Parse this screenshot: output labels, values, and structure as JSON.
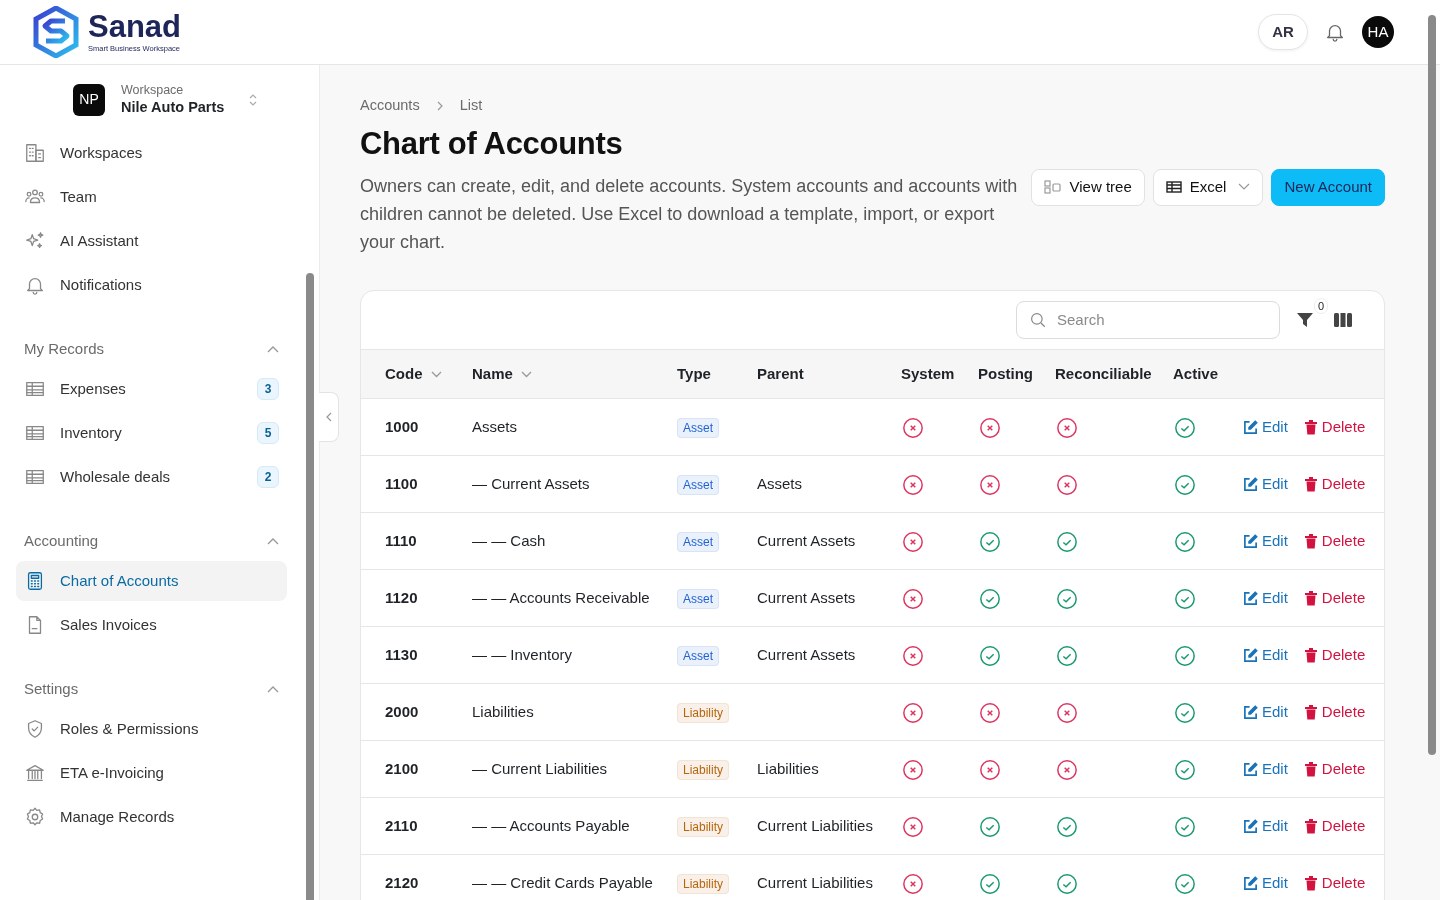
{
  "brand": {
    "name": "Sanad",
    "tagline": "Smart Business Workspace"
  },
  "header": {
    "language": "AR",
    "avatar": "HA"
  },
  "workspace": {
    "label": "Workspace",
    "name": "Nile Auto Parts",
    "initials": "NP"
  },
  "sidebar": {
    "items": [
      {
        "label": "Workspaces",
        "selected": false
      },
      {
        "label": "Team",
        "selected": false
      },
      {
        "label": "AI Assistant",
        "selected": false
      },
      {
        "label": "Notifications",
        "selected": false
      }
    ],
    "sections": [
      {
        "title": "My Records",
        "expanded": true,
        "items": [
          {
            "label": "Expenses",
            "badge": "3",
            "selected": false
          },
          {
            "label": "Inventory",
            "badge": "5",
            "selected": false
          },
          {
            "label": "Wholesale deals",
            "badge": "2",
            "selected": false
          }
        ]
      },
      {
        "title": "Accounting",
        "expanded": true,
        "items": [
          {
            "label": "Chart of Accounts",
            "selected": true
          },
          {
            "label": "Sales Invoices",
            "selected": false
          }
        ]
      },
      {
        "title": "Settings",
        "expanded": true,
        "items": [
          {
            "label": "Roles & Permissions",
            "selected": false
          },
          {
            "label": "ETA e-Invoicing",
            "selected": false
          },
          {
            "label": "Manage Records",
            "selected": false
          }
        ]
      }
    ]
  },
  "breadcrumbs": [
    "Accounts",
    "List"
  ],
  "title": "Chart of Accounts",
  "description": "Owners can create, edit, and delete accounts. System accounts and accounts with children cannot be deleted. Use Excel to download a template, import, or export your chart.",
  "actions": [
    {
      "label": "View tree",
      "kind": "tree"
    },
    {
      "label": "Excel",
      "kind": "dropdown"
    },
    {
      "label": "New Account",
      "kind": "primary"
    }
  ],
  "table": {
    "search": {
      "placeholder": "Search"
    },
    "filter_count": "0",
    "columns": [
      {
        "label": "Code",
        "sortable": true
      },
      {
        "label": "Name",
        "sortable": true
      },
      {
        "label": "Type",
        "sortable": false
      },
      {
        "label": "Parent",
        "sortable": false
      },
      {
        "label": "System",
        "sortable": false
      },
      {
        "label": "Posting",
        "sortable": false
      },
      {
        "label": "Reconciliable",
        "sortable": false
      },
      {
        "label": "Active",
        "sortable": false
      }
    ],
    "rows": [
      {
        "code": "1000",
        "name": "Assets",
        "type": {
          "label": "Asset",
          "color": "#1f63d6"
        },
        "parent": "",
        "system": false,
        "posting": false,
        "reconcilable": false,
        "active": true,
        "edit": "Edit",
        "delete": "Delete"
      },
      {
        "code": "1100",
        "name": "— Current Assets",
        "type": {
          "label": "Asset",
          "color": "#1f63d6"
        },
        "parent": "Assets",
        "system": false,
        "posting": false,
        "reconcilable": false,
        "active": true,
        "edit": "Edit",
        "delete": "Delete"
      },
      {
        "code": "1110",
        "name": "— — Cash",
        "type": {
          "label": "Asset",
          "color": "#1f63d6"
        },
        "parent": "Current Assets",
        "system": false,
        "posting": true,
        "reconcilable": true,
        "active": true,
        "edit": "Edit",
        "delete": "Delete"
      },
      {
        "code": "1120",
        "name": "— — Accounts Receivable",
        "type": {
          "label": "Asset",
          "color": "#1f63d6"
        },
        "parent": "Current Assets",
        "system": false,
        "posting": true,
        "reconcilable": true,
        "active": true,
        "edit": "Edit",
        "delete": "Delete"
      },
      {
        "code": "1130",
        "name": "— — Inventory",
        "type": {
          "label": "Asset",
          "color": "#1f63d6"
        },
        "parent": "Current Assets",
        "system": false,
        "posting": true,
        "reconcilable": true,
        "active": true,
        "edit": "Edit",
        "delete": "Delete"
      },
      {
        "code": "2000",
        "name": "Liabilities",
        "type": {
          "label": "Liability",
          "color": "#b8650c"
        },
        "parent": "",
        "system": false,
        "posting": false,
        "reconcilable": false,
        "active": true,
        "edit": "Edit",
        "delete": "Delete"
      },
      {
        "code": "2100",
        "name": "— Current Liabilities",
        "type": {
          "label": "Liability",
          "color": "#b8650c"
        },
        "parent": "Liabilities",
        "system": false,
        "posting": false,
        "reconcilable": false,
        "active": true,
        "edit": "Edit",
        "delete": "Delete"
      },
      {
        "code": "2110",
        "name": "— — Accounts Payable",
        "type": {
          "label": "Liability",
          "color": "#b8650c"
        },
        "parent": "Current Liabilities",
        "system": false,
        "posting": true,
        "reconcilable": true,
        "active": true,
        "edit": "Edit",
        "delete": "Delete"
      },
      {
        "code": "2120",
        "name": "— — Credit Cards Payable",
        "type": {
          "label": "Liability",
          "color": "#b8650c"
        },
        "parent": "Current Liabilities",
        "system": false,
        "posting": true,
        "reconcilable": true,
        "active": true,
        "edit": "Edit",
        "delete": "Delete"
      }
    ]
  }
}
